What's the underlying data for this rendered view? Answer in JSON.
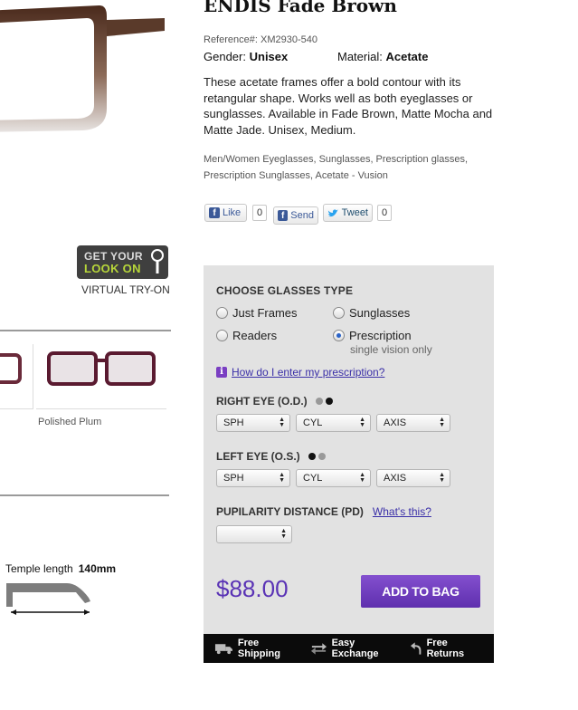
{
  "product": {
    "title": "ENDIS Fade Brown",
    "reference_label": "Reference#:",
    "reference": "XM2930-540",
    "gender_label": "Gender:",
    "gender": "Unisex",
    "material_label": "Material:",
    "material": "Acetate",
    "description": "These acetate frames offer a bold contour with its retangular shape. Works well as both eyeglasses or sunglasses. Available in Fade Brown, Matte Mocha and Matte Jade. Unisex, Medium.",
    "tags": "Men/Women Eyeglasses, Sunglasses, Prescription glasses, Prescription Sunglasses, Acetate - Vusion"
  },
  "social": {
    "like_label": "Like",
    "like_count": "0",
    "send_label": "Send",
    "tweet_label": "Tweet",
    "tweet_count": "0"
  },
  "tryon": {
    "line1": "GET YOUR",
    "line2": "LOOK ON",
    "label": "VIRTUAL TRY-ON"
  },
  "swatches": {
    "selected_label": "Polished Plum"
  },
  "temple": {
    "label": "Temple length",
    "value": "140mm"
  },
  "options": {
    "title": "CHOOSE GLASSES TYPE",
    "types": [
      {
        "label": "Just Frames",
        "selected": false
      },
      {
        "label": "Sunglasses",
        "selected": false
      },
      {
        "label": "Readers",
        "selected": false
      },
      {
        "label": "Prescription",
        "selected": true
      }
    ],
    "prescription_sub": "single vision only",
    "help_link": "How do I enter my prescription?",
    "right_eye_label": "RIGHT EYE (O.D.)",
    "left_eye_label": "LEFT EYE (O.S.)",
    "selects": [
      "SPH",
      "CYL",
      "AXIS"
    ],
    "pd_label": "PUPILARITY DISTANCE (PD)",
    "pd_link": "What's this?",
    "pd_value": "",
    "price": "$88.00",
    "add_label": "ADD TO BAG"
  },
  "footer": {
    "items": [
      "Free Shipping",
      "Easy Exchange",
      "Free Returns"
    ]
  },
  "colors": {
    "accent": "#5a33b5",
    "panel_bg": "#e2e2e2",
    "link": "#3a2fa8"
  }
}
